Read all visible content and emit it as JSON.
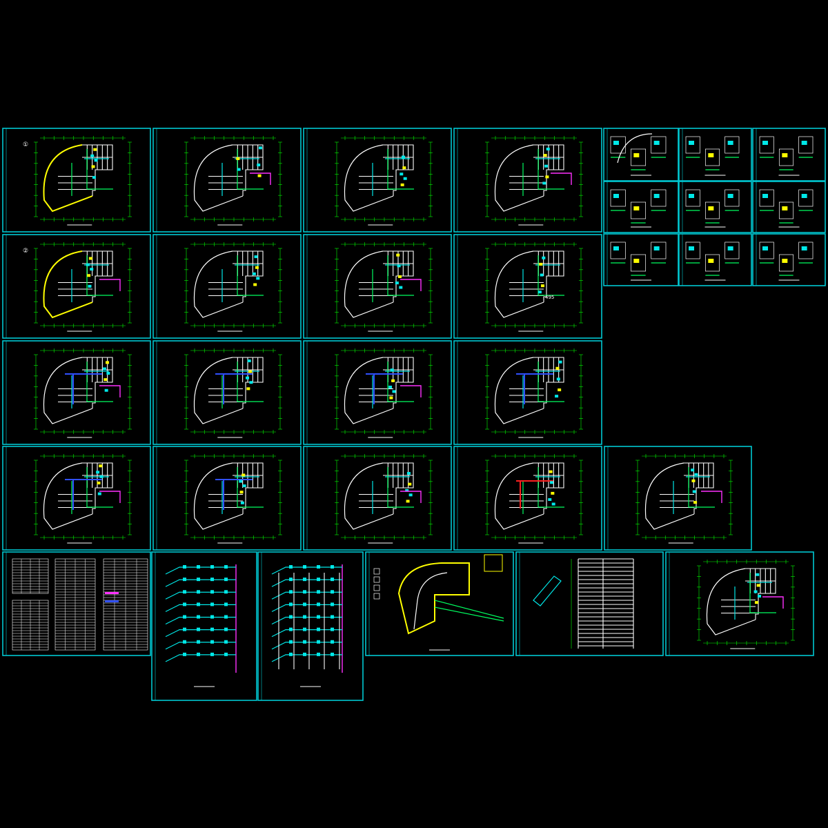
{
  "drawing": {
    "background": "#000000",
    "frame_color": "#00c8d2",
    "layer_colors": {
      "wall": "#ffffff",
      "curtain_wall": "#ffff00",
      "supply_duct": "#00e8e8",
      "exhaust_duct": "#00ff60",
      "main_duct": "#3050ff",
      "pipe": "#ff30ff",
      "fire_damper": "#ff2020"
    }
  },
  "plan_labels": {
    "sheet_0_mark": "①",
    "sheet_4_mark": "②",
    "sheet_7_room": "495"
  }
}
